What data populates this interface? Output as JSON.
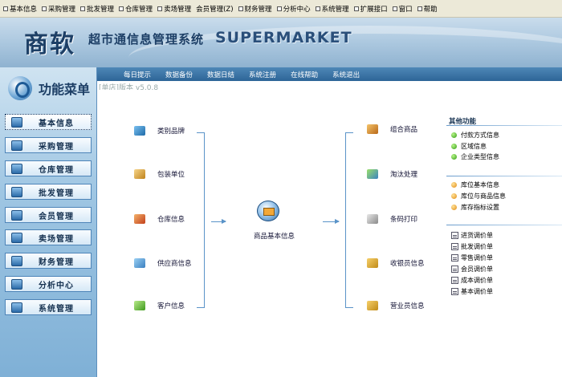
{
  "menubar": {
    "items": [
      {
        "label": "基本信息"
      },
      {
        "label": "采购管理"
      },
      {
        "label": "批发管理"
      },
      {
        "label": "仓库管理"
      },
      {
        "label": "卖场管理"
      },
      {
        "label": "会员管理(Z)"
      },
      {
        "label": "财务管理"
      },
      {
        "label": "分析中心"
      },
      {
        "label": "系统管理"
      },
      {
        "label": "扩展接口"
      },
      {
        "label": "窗口"
      },
      {
        "label": "帮助"
      }
    ]
  },
  "banner": {
    "brand": "商软",
    "subtitle": "超市通信息管理系统",
    "supermarket": "SUPERMARKET"
  },
  "sidebar": {
    "title": "功能菜单",
    "items": [
      {
        "label": "基本信息",
        "active": true
      },
      {
        "label": "采购管理"
      },
      {
        "label": "仓库管理"
      },
      {
        "label": "批发管理"
      },
      {
        "label": "会员管理"
      },
      {
        "label": "卖场管理"
      },
      {
        "label": "财务管理"
      },
      {
        "label": "分析中心"
      },
      {
        "label": "系统管理"
      }
    ]
  },
  "toolbar": {
    "links": [
      "每日提示",
      "数据备份",
      "数据日结",
      "系统注册",
      "在线帮助",
      "系统退出"
    ]
  },
  "version": "[单店]版本 v5.0.8",
  "main": {
    "left_nodes": [
      "类别品牌",
      "包装单位",
      "仓库信息",
      "供应商信息",
      "客户信息"
    ],
    "center_label": "商品基本信息",
    "right_nodes": [
      "组合商品",
      "淘汰处理",
      "条码打印",
      "收银员信息",
      "营业员信息"
    ]
  },
  "right_panel": {
    "title": "其他功能",
    "group1": [
      "付款方式信息",
      "区域信息",
      "企业类型信息"
    ],
    "group2": [
      "库位基本信息",
      "库位与商品信息",
      "库存指标设置"
    ],
    "group3": [
      "进货调价单",
      "批发调价单",
      "零售调价单",
      "会员调价单",
      "成本调价单",
      "基本调价单"
    ]
  }
}
